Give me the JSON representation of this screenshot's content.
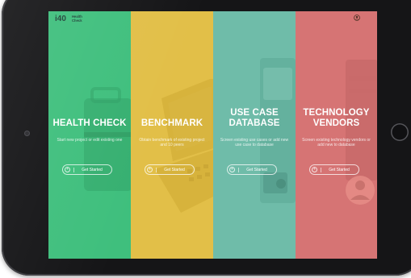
{
  "app": {
    "logo_mark": "i40",
    "logo_sub_line1": "Health",
    "logo_sub_line2": "Check"
  },
  "panels": [
    {
      "title_line1": "HEALTH CHECK",
      "description": "Start new project or edit existing one",
      "cta_label": "Get Started",
      "color": "#3fbf7d"
    },
    {
      "title_line1": "BENCHMARK",
      "description": "Obtain benchmark of existing project and 10 peers",
      "cta_label": "Get Started",
      "color": "#e2bf48"
    },
    {
      "title_line1": "USE CASE",
      "title_line2": "DATABASE",
      "description": "Screen existing use cases or add new use case to database",
      "cta_label": "Get Started",
      "color": "#6fbca9"
    },
    {
      "title_line1": "TECHNOLOGY",
      "title_line2": "VENDORS",
      "description": "Screen existing technology vendors or add new to database",
      "cta_label": "Get Started",
      "color": "#d67474"
    }
  ],
  "icons": {
    "profile": "user-icon",
    "cta": "plus-icon"
  }
}
